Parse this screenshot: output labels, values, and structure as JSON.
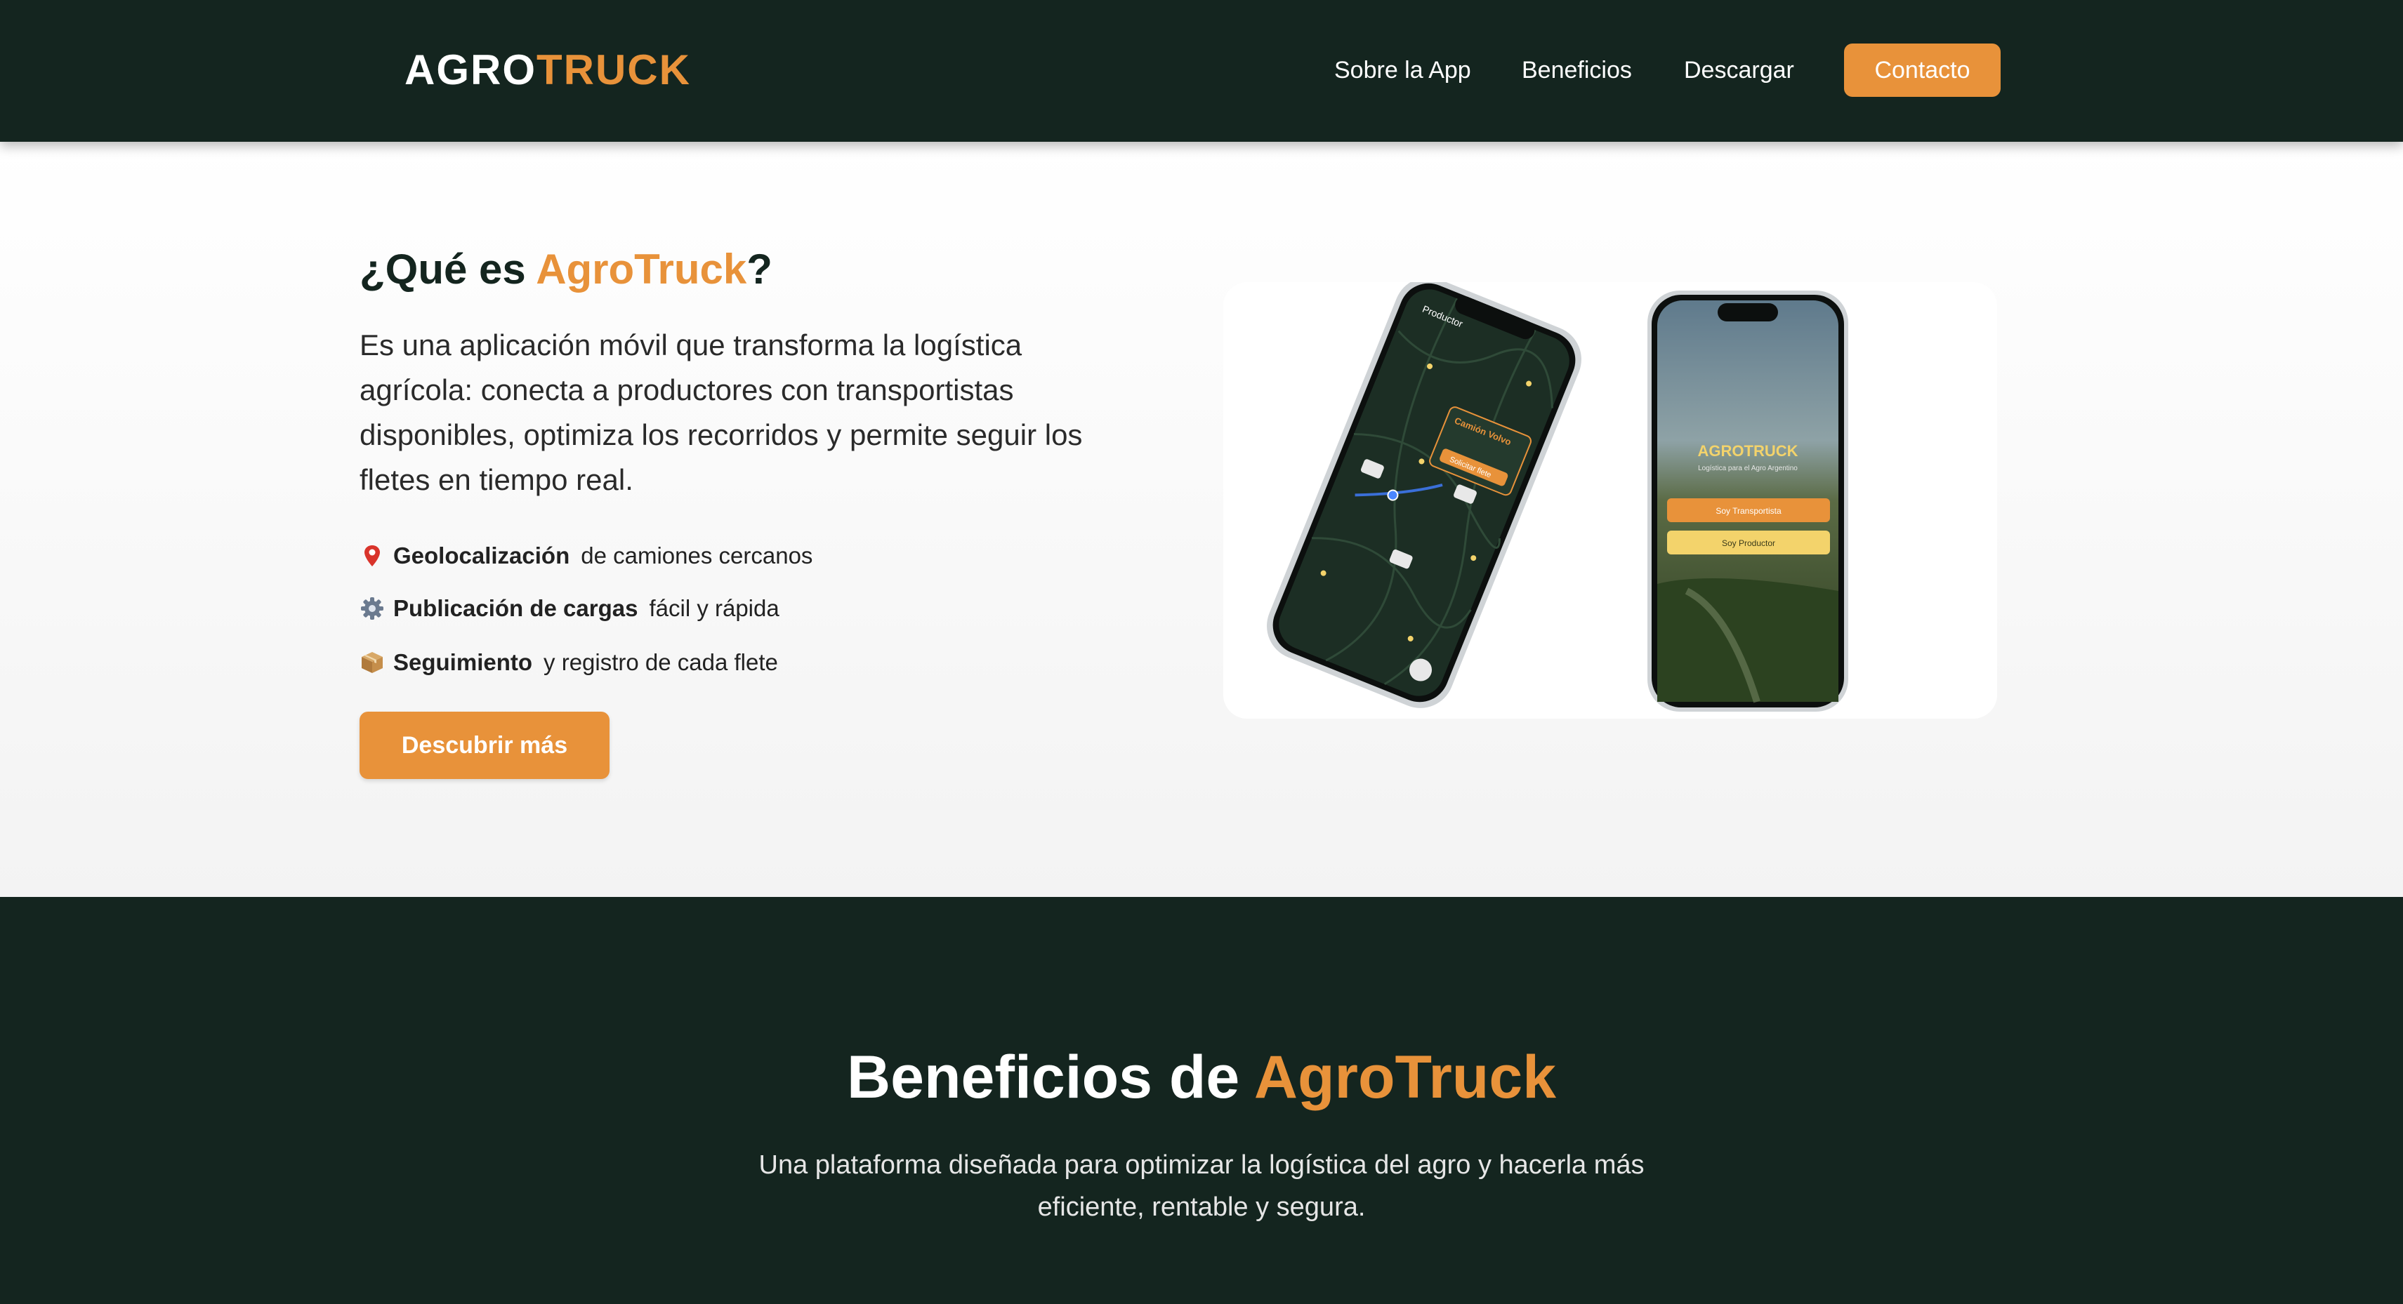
{
  "header": {
    "logo_part1": "AGRO",
    "logo_part2": "TRUCK",
    "nav": [
      {
        "label": "Sobre la App"
      },
      {
        "label": "Beneficios"
      },
      {
        "label": "Descargar"
      }
    ],
    "contact_label": "Contacto"
  },
  "about": {
    "title_prefix": "¿Qué es ",
    "title_brand": "AgroTruck",
    "title_suffix": "?",
    "description": "Es una aplicación móvil que transforma la logística agrícola: conecta a productores con transportistas disponibles, optimiza los recorridos y permite seguir los fletes en tiempo real.",
    "features": [
      {
        "icon": "map-pin-icon",
        "bold": "Geolocalización",
        "text": "de camiones cercanos"
      },
      {
        "icon": "gear-icon",
        "bold": "Publicación de cargas",
        "text": "fácil y rápida"
      },
      {
        "icon": "package-icon",
        "bold": "Seguimiento",
        "text": "y registro de cada flete"
      }
    ],
    "cta_label": "Descubrir más"
  },
  "phones": {
    "map_back_label": "Productor",
    "map_card_title": "Camión Volvo",
    "map_card_button": "Solicitar flete",
    "app_logo": "AGROTRUCK",
    "app_tagline": "Logística para el Agro Argentino",
    "role_buttons": [
      "Soy Transportista",
      "Soy Productor"
    ]
  },
  "benefits": {
    "title_prefix": "Beneficios de ",
    "title_brand": "AgroTruck",
    "subtitle": "Una plataforma diseñada para optimizar la logística del agro y hacerla más eficiente, rentable y segura."
  },
  "colors": {
    "dark_green": "#14251f",
    "accent_orange": "#e8923a",
    "yellow": "#f3d36b"
  }
}
